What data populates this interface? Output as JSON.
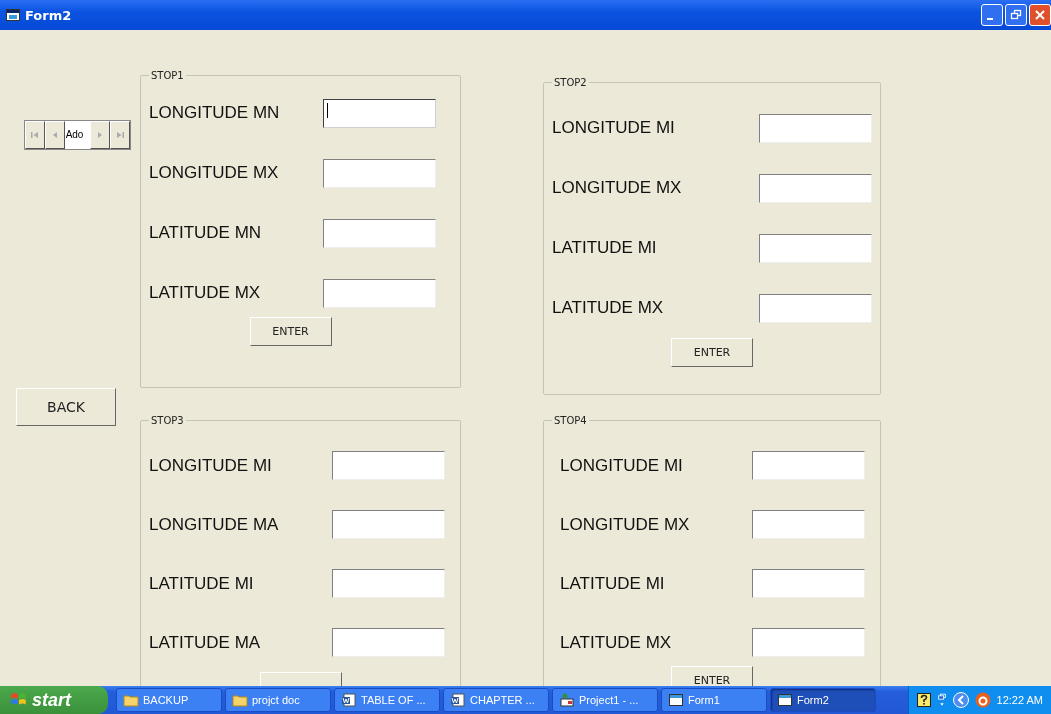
{
  "window": {
    "title": "Form2"
  },
  "ado_control": {
    "caption": "Ado"
  },
  "back_button": "BACK",
  "frames": [
    {
      "title": "STOP1",
      "fields": [
        {
          "label": "LONGITUDE MN",
          "focused": true
        },
        {
          "label": "LONGITUDE MX",
          "focused": false
        },
        {
          "label": "LATITUDE MN",
          "focused": false
        },
        {
          "label": "LATITUDE MX",
          "focused": false
        }
      ],
      "button": "ENTER"
    },
    {
      "title": "STOP2",
      "fields": [
        {
          "label": "LONGITUDE MI",
          "focused": false
        },
        {
          "label": "LONGITUDE MX",
          "focused": false
        },
        {
          "label": "LATITUDE MI",
          "focused": false
        },
        {
          "label": "LATITUDE MX",
          "focused": false
        }
      ],
      "button": "ENTER"
    },
    {
      "title": "STOP3",
      "fields": [
        {
          "label": "LONGITUDE MI",
          "focused": false
        },
        {
          "label": "LONGITUDE MA",
          "focused": false
        },
        {
          "label": "LATITUDE MI",
          "focused": false
        },
        {
          "label": "LATITUDE MA",
          "focused": false
        }
      ]
    },
    {
      "title": "STOP4",
      "fields": [
        {
          "label": "LONGITUDE MI",
          "focused": false
        },
        {
          "label": "LONGITUDE MX",
          "focused": false
        },
        {
          "label": "LATITUDE MI",
          "focused": false
        },
        {
          "label": "LATITUDE MX",
          "focused": false
        }
      ],
      "button": "ENTER"
    }
  ],
  "taskbar": {
    "start": "start",
    "items": [
      {
        "label": "BACKUP",
        "kind": "folder",
        "selected": false
      },
      {
        "label": "projct doc",
        "kind": "folder",
        "selected": false
      },
      {
        "label": "TABLE OF ...",
        "kind": "word",
        "selected": false
      },
      {
        "label": "CHAPTER ...",
        "kind": "word",
        "selected": false
      },
      {
        "label": "Project1 - ...",
        "kind": "project",
        "selected": false
      },
      {
        "label": "Form1",
        "kind": "form",
        "selected": false
      },
      {
        "label": "Form2",
        "kind": "form",
        "selected": true
      }
    ],
    "clock": "12:22 AM"
  }
}
